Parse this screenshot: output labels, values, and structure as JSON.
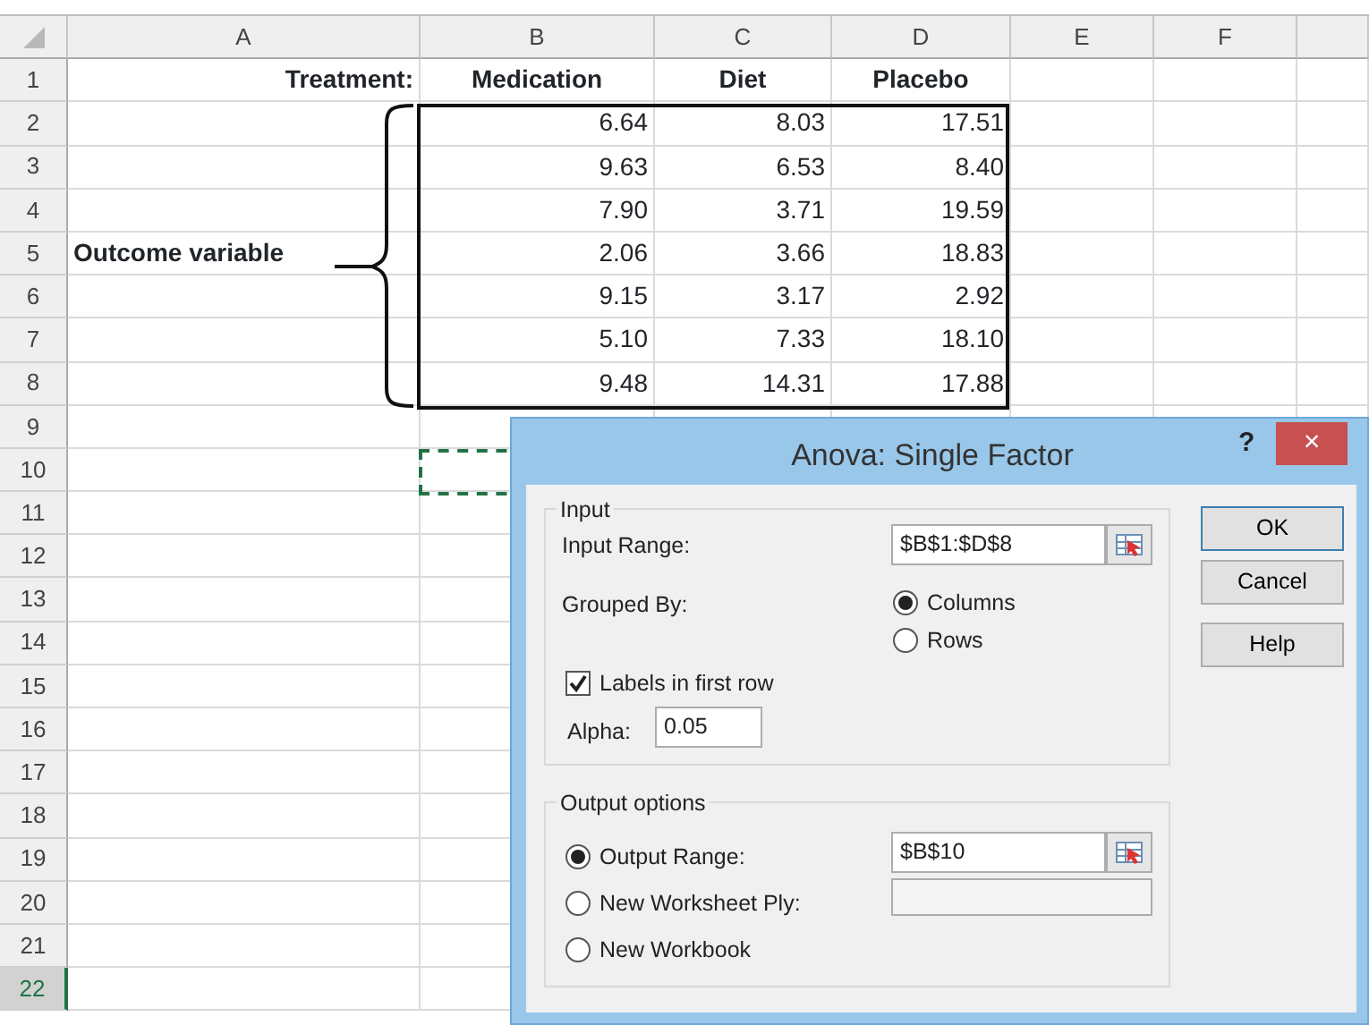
{
  "spreadsheet": {
    "columns": [
      "A",
      "B",
      "C",
      "D",
      "E",
      "F"
    ],
    "rows": [
      {
        "number": "1",
        "kind": "header",
        "label": "Treatment:",
        "values": [
          "Medication",
          "Diet",
          "Placebo"
        ],
        "selected": false
      },
      {
        "number": "2",
        "kind": "data",
        "values": [
          "6.64",
          "8.03",
          "17.51"
        ],
        "selected": false
      },
      {
        "number": "3",
        "kind": "data",
        "values": [
          "9.63",
          "6.53",
          "8.40"
        ],
        "selected": false
      },
      {
        "number": "4",
        "kind": "data",
        "values": [
          "7.90",
          "3.71",
          "19.59"
        ],
        "selected": false
      },
      {
        "number": "5",
        "kind": "data",
        "label": "Outcome variable",
        "values": [
          "2.06",
          "3.66",
          "18.83"
        ],
        "selected": false
      },
      {
        "number": "6",
        "kind": "data",
        "values": [
          "9.15",
          "3.17",
          "2.92"
        ],
        "selected": false
      },
      {
        "number": "7",
        "kind": "data",
        "values": [
          "5.10",
          "7.33",
          "18.10"
        ],
        "selected": false
      },
      {
        "number": "8",
        "kind": "data",
        "values": [
          "9.48",
          "14.31",
          "17.88"
        ],
        "selected": false
      },
      {
        "number": "9",
        "kind": "empty",
        "selected": false
      },
      {
        "number": "10",
        "kind": "empty",
        "selected": false
      },
      {
        "number": "11",
        "kind": "empty",
        "selected": false
      },
      {
        "number": "12",
        "kind": "empty",
        "selected": false
      },
      {
        "number": "13",
        "kind": "empty",
        "selected": false
      },
      {
        "number": "14",
        "kind": "empty",
        "selected": false
      },
      {
        "number": "15",
        "kind": "empty",
        "selected": false
      },
      {
        "number": "16",
        "kind": "empty",
        "selected": false
      },
      {
        "number": "17",
        "kind": "empty",
        "selected": false
      },
      {
        "number": "18",
        "kind": "empty",
        "selected": false
      },
      {
        "number": "19",
        "kind": "empty",
        "selected": false
      },
      {
        "number": "20",
        "kind": "empty",
        "selected": false
      },
      {
        "number": "21",
        "kind": "empty",
        "selected": false
      },
      {
        "number": "22",
        "kind": "empty",
        "selected": true
      }
    ]
  },
  "dialog": {
    "title": "Anova: Single Factor",
    "help": "?",
    "close": "×",
    "input": {
      "legend": "Input",
      "range_label": "Input Range:",
      "range_value": "$B$1:$D$8",
      "grouped_label": "Grouped By:",
      "grouped_options": [
        {
          "label": "Columns",
          "selected": true
        },
        {
          "label": "Rows",
          "selected": false
        }
      ],
      "labels_checkbox": {
        "label": "Labels in first row",
        "checked": true
      },
      "alpha_label": "Alpha:",
      "alpha_value": "0.05"
    },
    "output": {
      "legend": "Output options",
      "options": [
        {
          "label": "Output Range:",
          "selected": true,
          "value": "$B$10"
        },
        {
          "label": "New Worksheet Ply:",
          "selected": false,
          "field": true
        },
        {
          "label": "New Workbook",
          "selected": false
        }
      ]
    },
    "buttons": [
      "OK",
      "Cancel",
      "Help"
    ]
  }
}
